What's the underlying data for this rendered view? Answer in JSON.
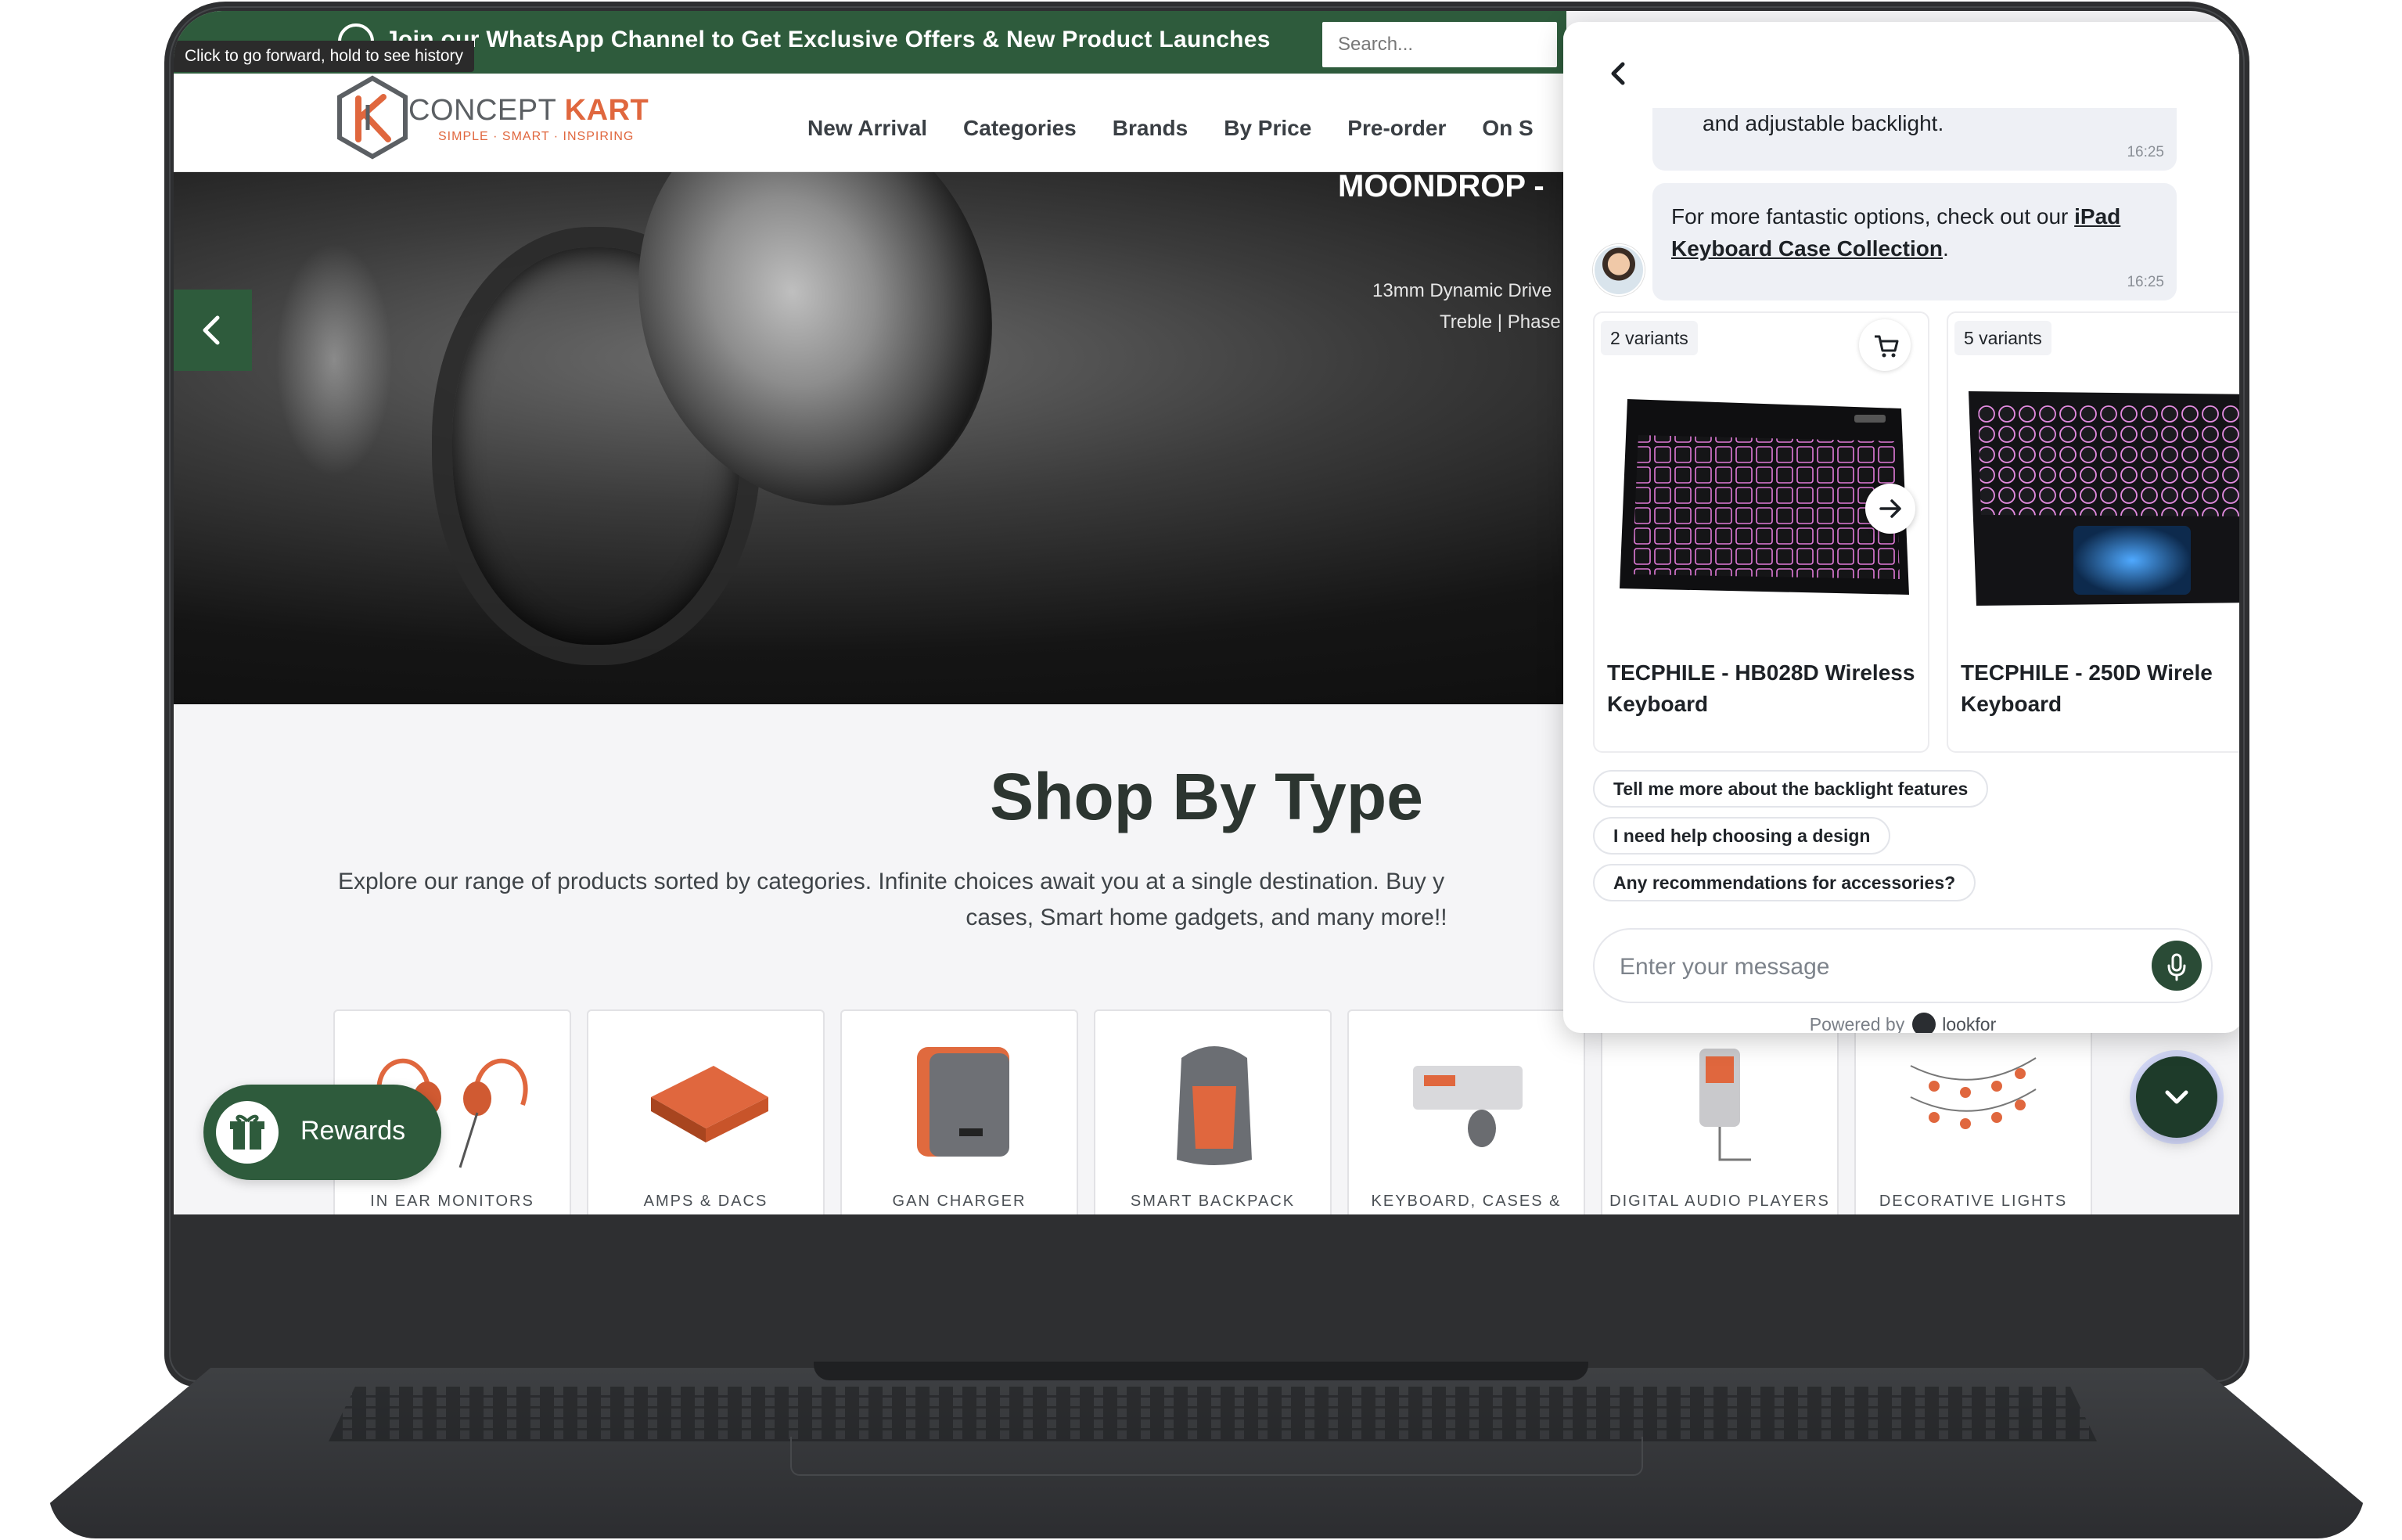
{
  "browser": {
    "tooltip": "Click to go forward, hold to see history"
  },
  "announcement": {
    "text": "Join our WhatsApp Channel to Get Exclusive Offers & New Product Launches",
    "search_placeholder": "Search..."
  },
  "header": {
    "logo_word1": "CONCEPT",
    "logo_word2": "KART",
    "logo_tagline": "SIMPLE · SMART · INSPIRING",
    "nav": [
      "New Arrival",
      "Categories",
      "Brands",
      "By Price",
      "Pre-order",
      "On S"
    ]
  },
  "hero": {
    "title": "MOONDROP -",
    "spec_line1": "13mm Dynamic Drive",
    "spec_line2": "Treble | Phase"
  },
  "shop": {
    "title": "Shop By Type",
    "desc_line1": "Explore our range of products sorted by categories. Infinite choices await you at a single destination. Buy y",
    "desc_line2": "cases, Smart home gadgets, and many more!!",
    "types": [
      {
        "label": "IN EAR MONITORS"
      },
      {
        "label": "AMPS & DACS"
      },
      {
        "label": "GAN CHARGER"
      },
      {
        "label": "SMART BACKPACK"
      },
      {
        "label": "KEYBOARD, CASES & MOUSE"
      },
      {
        "label": "DIGITAL AUDIO PLAYERS"
      },
      {
        "label": "DECORATIVE LIGHTS"
      }
    ]
  },
  "rewards": {
    "label": "Rewards"
  },
  "chat": {
    "messages": [
      {
        "text": "and adjustable backlight.",
        "time": "16:25"
      },
      {
        "text_before": "For more fantastic options, check out our ",
        "link": "iPad Keyboard Case Collection",
        "text_after": ".",
        "time": "16:25"
      }
    ],
    "products": [
      {
        "badge": "2 variants",
        "name_line1": "TECPHILE - HB028D Wireless",
        "name_line2": "Keyboard"
      },
      {
        "badge": "5 variants",
        "name_line1": "TECPHILE - 250D Wirele",
        "name_line2": "Keyboard"
      }
    ],
    "suggestions": [
      "Tell me more about the backlight features",
      "I need help choosing a design",
      "Any recommendations for accessories?"
    ],
    "input_placeholder": "Enter your message",
    "powered_by": "Powered by",
    "powered_brand": "lookfor"
  },
  "colors": {
    "brand_green": "#2e5b3c",
    "brand_orange": "#e0673e",
    "laptop_body": "#2e2f31"
  }
}
